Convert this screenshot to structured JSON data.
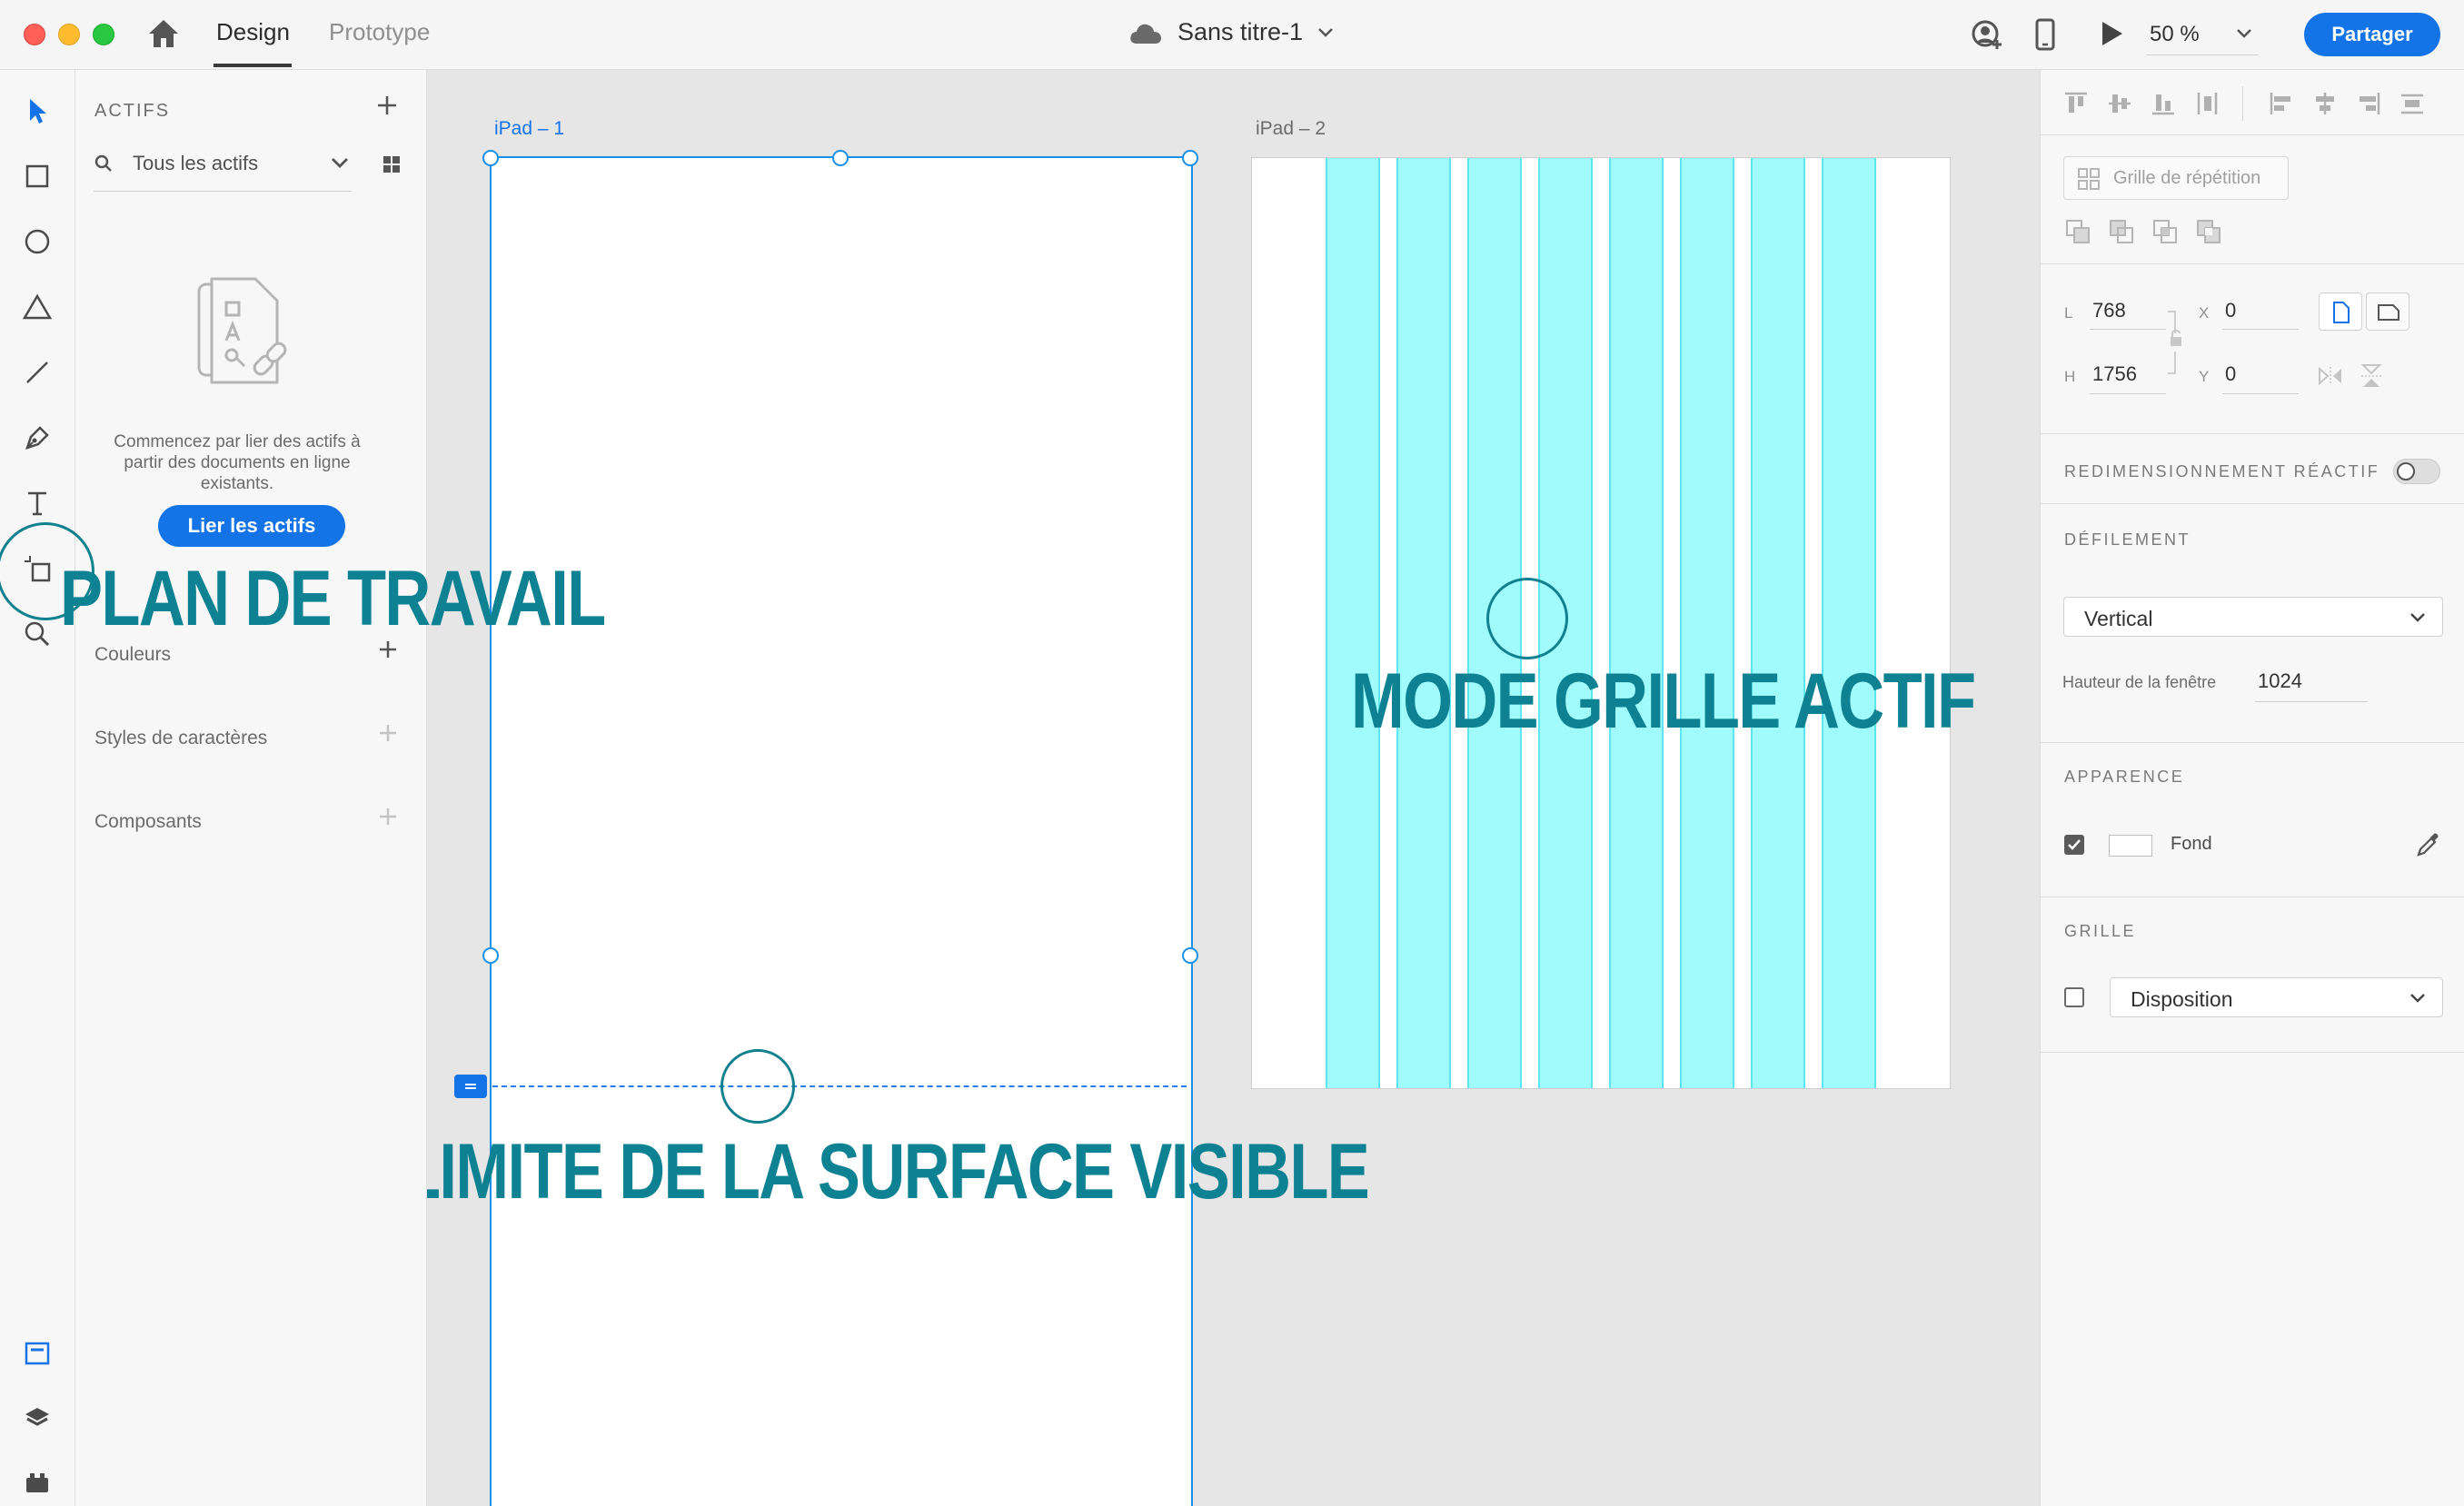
{
  "topbar": {
    "tab_design": "Design",
    "tab_prototype": "Prototype",
    "document_title": "Sans titre-1",
    "zoom_level": "50 %",
    "share_label": "Partager"
  },
  "assets": {
    "title": "ACTIFS",
    "filter_label": "Tous les actifs",
    "empty_text": "Commencez par lier des actifs à partir des documents en ligne existants.",
    "link_button": "Lier les actifs",
    "sections": {
      "colors": "Couleurs",
      "char_styles": "Styles de caractères",
      "components": "Composants"
    }
  },
  "canvas": {
    "artboard1_label": "iPad – 1",
    "artboard2_label": "iPad – 2",
    "annotations": {
      "artboard_tool": "PLAN DE TRAVAIL",
      "grid_mode": "MODE GRILLE ACTIF",
      "visible_limit": "LIMITE DE LA SURFACE VISIBLE"
    }
  },
  "inspector": {
    "repeat_grid": "Grille de répétition",
    "width_letter": "L",
    "width_value": "768",
    "height_letter": "H",
    "height_value": "1756",
    "x_letter": "X",
    "x_value": "0",
    "y_letter": "Y",
    "y_value": "0",
    "responsive_resize": "REDIMENSIONNEMENT RÉACTIF",
    "scrolling_title": "DÉFILEMENT",
    "scrolling_value": "Vertical",
    "viewport_height_label": "Hauteur de la fenêtre",
    "viewport_height_value": "1024",
    "appearance_title": "APPARENCE",
    "fill_label": "Fond",
    "grid_title": "GRILLE",
    "grid_value": "Disposition"
  },
  "colors": {
    "accent": "#1473e6",
    "grid_column": "#a0fcfc",
    "annotation": "#0e8293"
  }
}
